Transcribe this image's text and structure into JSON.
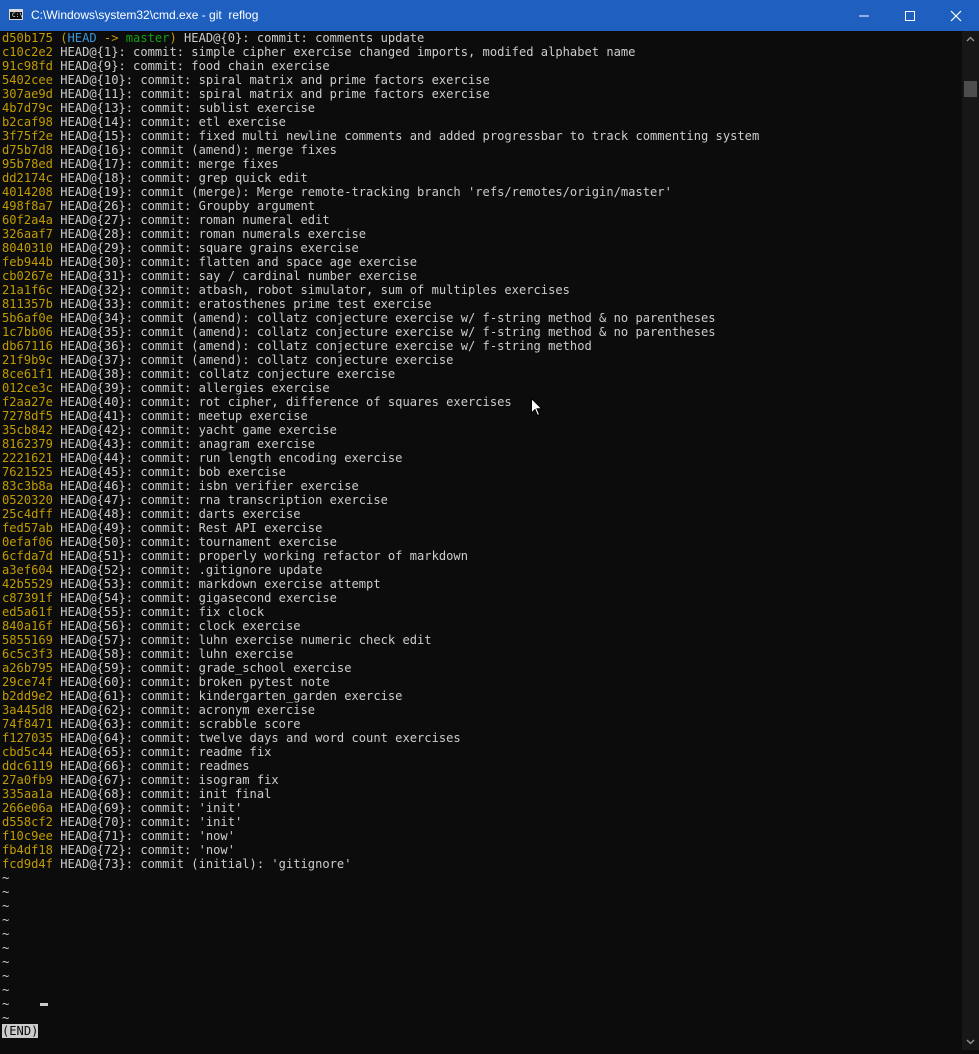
{
  "window": {
    "title": "C:\\Windows\\system32\\cmd.exe - git  reflog",
    "icon_text": "C:\\"
  },
  "decoration": {
    "open": "(",
    "head": "HEAD",
    "arrow": " -> ",
    "branch": "master",
    "close": ")"
  },
  "entries": [
    {
      "hash": "d50b175",
      "ref": " HEAD@{0}: commit: comments update"
    },
    {
      "hash": "c10c2e2",
      "ref": " HEAD@{1}: commit: simple cipher exercise changed imports, modifed alphabet name"
    },
    {
      "hash": "91c98fd",
      "ref": " HEAD@{9}: commit: food chain exercise"
    },
    {
      "hash": "5402cee",
      "ref": " HEAD@{10}: commit: spiral matrix and prime factors exercise"
    },
    {
      "hash": "307ae9d",
      "ref": " HEAD@{11}: commit: spiral matrix and prime factors exercise"
    },
    {
      "hash": "4b7d79c",
      "ref": " HEAD@{13}: commit: sublist exercise"
    },
    {
      "hash": "b2caf98",
      "ref": " HEAD@{14}: commit: etl exercise"
    },
    {
      "hash": "3f75f2e",
      "ref": " HEAD@{15}: commit: fixed multi newline comments and added progressbar to track commenting system"
    },
    {
      "hash": "d75b7d8",
      "ref": " HEAD@{16}: commit (amend): merge fixes"
    },
    {
      "hash": "95b78ed",
      "ref": " HEAD@{17}: commit: merge fixes"
    },
    {
      "hash": "dd2174c",
      "ref": " HEAD@{18}: commit: grep quick edit"
    },
    {
      "hash": "4014208",
      "ref": " HEAD@{19}: commit (merge): Merge remote-tracking branch 'refs/remotes/origin/master'"
    },
    {
      "hash": "498f8a7",
      "ref": " HEAD@{26}: commit: Groupby argument"
    },
    {
      "hash": "60f2a4a",
      "ref": " HEAD@{27}: commit: roman numeral edit"
    },
    {
      "hash": "326aaf7",
      "ref": " HEAD@{28}: commit: roman numerals exercise"
    },
    {
      "hash": "8040310",
      "ref": " HEAD@{29}: commit: square grains exercise"
    },
    {
      "hash": "feb944b",
      "ref": " HEAD@{30}: commit: flatten and space age exercise"
    },
    {
      "hash": "cb0267e",
      "ref": " HEAD@{31}: commit: say / cardinal number exercise"
    },
    {
      "hash": "21a1f6c",
      "ref": " HEAD@{32}: commit: atbash, robot simulator, sum of multiples exercises"
    },
    {
      "hash": "811357b",
      "ref": " HEAD@{33}: commit: eratosthenes prime test exercise"
    },
    {
      "hash": "5b6af0e",
      "ref": " HEAD@{34}: commit (amend): collatz conjecture exercise w/ f-string method & no parentheses"
    },
    {
      "hash": "1c7bb06",
      "ref": " HEAD@{35}: commit (amend): collatz conjecture exercise w/ f-string method & no parentheses"
    },
    {
      "hash": "db67116",
      "ref": " HEAD@{36}: commit (amend): collatz conjecture exercise w/ f-string method"
    },
    {
      "hash": "21f9b9c",
      "ref": " HEAD@{37}: commit (amend): collatz conjecture exercise"
    },
    {
      "hash": "8ce61f1",
      "ref": " HEAD@{38}: commit: collatz conjecture exercise"
    },
    {
      "hash": "012ce3c",
      "ref": " HEAD@{39}: commit: allergies exercise"
    },
    {
      "hash": "f2aa27e",
      "ref": " HEAD@{40}: commit: rot cipher, difference of squares exercises"
    },
    {
      "hash": "7278df5",
      "ref": " HEAD@{41}: commit: meetup exercise"
    },
    {
      "hash": "35cb842",
      "ref": " HEAD@{42}: commit: yacht game exercise"
    },
    {
      "hash": "8162379",
      "ref": " HEAD@{43}: commit: anagram exercise"
    },
    {
      "hash": "2221621",
      "ref": " HEAD@{44}: commit: run length encoding exercise"
    },
    {
      "hash": "7621525",
      "ref": " HEAD@{45}: commit: bob exercise"
    },
    {
      "hash": "83c3b8a",
      "ref": " HEAD@{46}: commit: isbn verifier exercise"
    },
    {
      "hash": "0520320",
      "ref": " HEAD@{47}: commit: rna transcription exercise"
    },
    {
      "hash": "25c4dff",
      "ref": " HEAD@{48}: commit: darts exercise"
    },
    {
      "hash": "fed57ab",
      "ref": " HEAD@{49}: commit: Rest API exercise"
    },
    {
      "hash": "0efaf06",
      "ref": " HEAD@{50}: commit: tournament exercise"
    },
    {
      "hash": "6cfda7d",
      "ref": " HEAD@{51}: commit: properly working refactor of markdown"
    },
    {
      "hash": "a3ef604",
      "ref": " HEAD@{52}: commit: .gitignore update"
    },
    {
      "hash": "42b5529",
      "ref": " HEAD@{53}: commit: markdown exercise attempt"
    },
    {
      "hash": "c87391f",
      "ref": " HEAD@{54}: commit: gigasecond exercise"
    },
    {
      "hash": "ed5a61f",
      "ref": " HEAD@{55}: commit: fix clock"
    },
    {
      "hash": "840a16f",
      "ref": " HEAD@{56}: commit: clock exercise"
    },
    {
      "hash": "5855169",
      "ref": " HEAD@{57}: commit: luhn exercise numeric check edit"
    },
    {
      "hash": "6c5c3f3",
      "ref": " HEAD@{58}: commit: luhn exercise"
    },
    {
      "hash": "a26b795",
      "ref": " HEAD@{59}: commit: grade_school exercise"
    },
    {
      "hash": "29ce74f",
      "ref": " HEAD@{60}: commit: broken pytest note"
    },
    {
      "hash": "b2dd9e2",
      "ref": " HEAD@{61}: commit: kindergarten_garden exercise"
    },
    {
      "hash": "3a445d8",
      "ref": " HEAD@{62}: commit: acronym exercise"
    },
    {
      "hash": "74f8471",
      "ref": " HEAD@{63}: commit: scrabble score"
    },
    {
      "hash": "f127035",
      "ref": " HEAD@{64}: commit: twelve days and word count exercises"
    },
    {
      "hash": "cbd5c44",
      "ref": " HEAD@{65}: commit: readme fix"
    },
    {
      "hash": "ddc6119",
      "ref": " HEAD@{66}: commit: readmes"
    },
    {
      "hash": "27a0fb9",
      "ref": " HEAD@{67}: commit: isogram fix"
    },
    {
      "hash": "335aa1a",
      "ref": " HEAD@{68}: commit: init final"
    },
    {
      "hash": "266e06a",
      "ref": " HEAD@{69}: commit: 'init'"
    },
    {
      "hash": "d558cf2",
      "ref": " HEAD@{70}: commit: 'init'"
    },
    {
      "hash": "f10c9ee",
      "ref": " HEAD@{71}: commit: 'now'"
    },
    {
      "hash": "fb4df18",
      "ref": " HEAD@{72}: commit: 'now'"
    },
    {
      "hash": "fcd9d4f",
      "ref": " HEAD@{73}: commit (initial): 'gitignore'"
    }
  ],
  "filler": "~",
  "pager_end": "(END)",
  "colors": {
    "hash": "#c19c00",
    "head": "#3a96dd",
    "branch": "#13a10e",
    "text": "#cccccc",
    "background": "#0c0c0c",
    "titlebar": "#1f5fbf"
  }
}
